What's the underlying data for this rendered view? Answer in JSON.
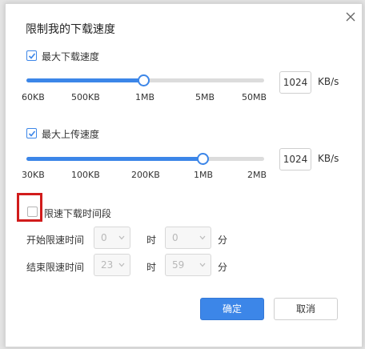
{
  "dialog": {
    "title": "限制我的下载速度"
  },
  "download": {
    "label": "最大下载速度",
    "checked": true,
    "value": "1024",
    "unit": "KB/s",
    "ticks": [
      "60KB",
      "500KB",
      "1MB",
      "5MB",
      "50MB"
    ]
  },
  "upload": {
    "label": "最大上传速度",
    "checked": true,
    "value": "1024",
    "unit": "KB/s",
    "ticks": [
      "30KB",
      "100KB",
      "200KB",
      "1MB",
      "2MB"
    ]
  },
  "schedule": {
    "label": "限速下载时间段",
    "checked": false,
    "start_label": "开始限速时间",
    "end_label": "结束限速时间",
    "start_hour": "0",
    "start_minute": "0",
    "end_hour": "23",
    "end_minute": "59",
    "hour_unit": "时",
    "minute_unit": "分"
  },
  "buttons": {
    "confirm": "确定",
    "cancel": "取消"
  },
  "colors": {
    "accent": "#3c86e8",
    "highlight": "#d11c1c"
  }
}
